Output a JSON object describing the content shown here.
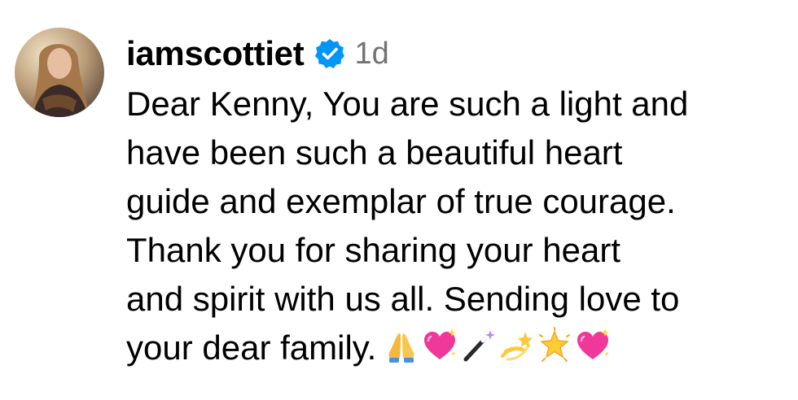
{
  "comment": {
    "username": "iamscottiet",
    "verified": true,
    "timestamp": "1d",
    "avatar_icon": "profile-photo-avatar",
    "text_lines": [
      "Dear Kenny, You are such a light and",
      "have been such a beautiful heart",
      "guide and exemplar of true courage.",
      "Thank you for sharing your heart",
      "and spirit with us all. Sending love to",
      "your dear family."
    ],
    "emojis": [
      {
        "name": "folded-hands-emoji",
        "char": "🙏"
      },
      {
        "name": "sparkling-heart-emoji",
        "char": "💖"
      },
      {
        "name": "magic-wand-emoji",
        "char": "🪄"
      },
      {
        "name": "dizzy-emoji",
        "char": "💫"
      },
      {
        "name": "glowing-star-emoji",
        "char": "🌟"
      },
      {
        "name": "sparkling-heart-emoji-2",
        "char": "💖"
      }
    ]
  },
  "colors": {
    "verified_badge": "#0095F6",
    "timestamp": "#737373",
    "text": "#000000",
    "background": "#FFFFFF"
  }
}
